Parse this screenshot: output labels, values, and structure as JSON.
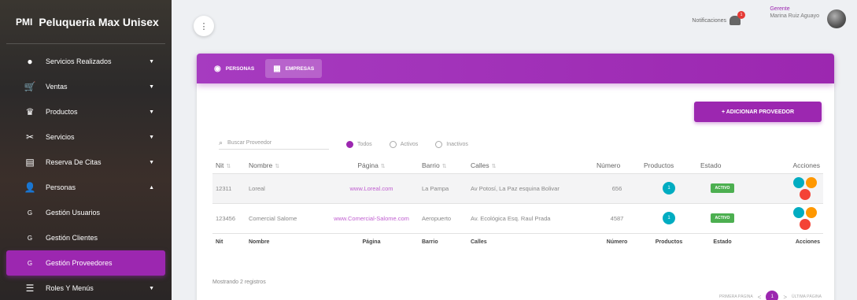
{
  "brand": {
    "abbr": "PMI",
    "name": "Peluqueria Max Unisex"
  },
  "sidebar": {
    "items": [
      {
        "icon": "●",
        "label": "Servicios Realizados",
        "caret": "▼"
      },
      {
        "icon": "🛒",
        "label": "Ventas",
        "caret": "▼"
      },
      {
        "icon": "♛",
        "label": "Productos",
        "caret": "▼"
      },
      {
        "icon": "✂",
        "label": "Servicios",
        "caret": "▼"
      },
      {
        "icon": "▤",
        "label": "Reserva De Citas",
        "caret": "▼"
      },
      {
        "icon": "👤",
        "label": "Personas",
        "caret": "▲"
      },
      {
        "icon": "G",
        "label": "Gestión Usuarios",
        "caret": ""
      },
      {
        "icon": "G",
        "label": "Gestión Clientes",
        "caret": ""
      },
      {
        "icon": "G",
        "label": "Gestión Proveedores",
        "caret": ""
      },
      {
        "icon": "☰",
        "label": "Roles Y Menús",
        "caret": "▼"
      }
    ]
  },
  "topbar": {
    "toggle": "⋮",
    "notifications_label": "Notificaciones",
    "notifications_count": "1",
    "user_role": "Gerente",
    "user_name": "Marina Ruiz Aguayo"
  },
  "tabs": [
    {
      "icon": "◉",
      "label": "PERSONAS"
    },
    {
      "icon": "▦",
      "label": "EMPRESAS"
    }
  ],
  "add_button": "+ ADICIONAR PROVEEDOR",
  "filters": {
    "search_placeholder": "Buscar Proveedor",
    "options": [
      "Todos",
      "Activos",
      "Inactivos"
    ],
    "selected": "Todos"
  },
  "table": {
    "headers": [
      "Nit",
      "Nombre",
      "Página",
      "Barrio",
      "Calles",
      "Número",
      "Productos",
      "Estado",
      "Acciones"
    ],
    "footer": [
      "Nit",
      "Nombre",
      "Página",
      "Barrio",
      "Calles",
      "Número",
      "Productos",
      "Estado",
      "Acciones"
    ],
    "rows": [
      {
        "nit": "12311",
        "nombre": "Loreal",
        "pagina": "www.Loreal.com",
        "barrio": "La Pampa",
        "calles": "Av Potosí, La Paz esquina Bolivar",
        "numero": "656",
        "productos": "1",
        "estado": "ACTIVO"
      },
      {
        "nit": "123456",
        "nombre": "Comercial Salome",
        "pagina": "www.Comercial-Salome.com",
        "barrio": "Aeropuerto",
        "calles": "Av. Ecológica Esq. Raul Prada",
        "numero": "4587",
        "productos": "1",
        "estado": "ACTIVO"
      }
    ]
  },
  "footer_text": "Mostrando 2 registros",
  "pager": {
    "first": "PRIMERA PÁGINA",
    "prev": "<",
    "page": "1",
    "next": ">",
    "last": "ÚLTIMA PÁGINA"
  },
  "colors": {
    "accent": "#9c27b0",
    "info": "#00acc1",
    "success": "#4caf50",
    "warning": "#ff9800",
    "danger": "#f44336"
  }
}
